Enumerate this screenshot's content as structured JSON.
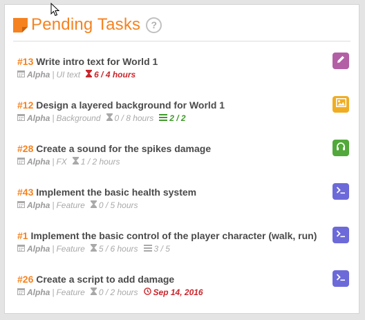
{
  "header": {
    "title": "Pending Tasks",
    "help": "?"
  },
  "colors": {
    "accent": "#f5821f",
    "overdue": "#c9262c",
    "done": "#3e9b27",
    "writing_badge": "#b35fa5",
    "art_badge": "#f0ad23",
    "sound_badge": "#52a83a",
    "code_badge": "#6c6ad9"
  },
  "tasks": [
    {
      "num": "#13",
      "title": "Write intro text for World 1",
      "milestone": "Alpha",
      "sep": "|",
      "category": "UI text",
      "hours": "6 / 4 hours",
      "badge_icon": "pencil-icon"
    },
    {
      "num": "#12",
      "title": "Design a layered background for World 1",
      "milestone": "Alpha",
      "sep": "|",
      "category": "Background",
      "hours": "0 / 8 hours",
      "subtasks": "2 / 2",
      "badge_icon": "image-icon"
    },
    {
      "num": "#28",
      "title": "Create a sound for the spikes damage",
      "milestone": "Alpha",
      "sep": "|",
      "category": "FX",
      "hours": "1 / 2 hours",
      "badge_icon": "headphones-icon"
    },
    {
      "num": "#43",
      "title": "Implement the basic health system",
      "milestone": "Alpha",
      "sep": "|",
      "category": "Feature",
      "hours": "0 / 5 hours",
      "badge_icon": "terminal-icon"
    },
    {
      "num": "#1",
      "title": "Implement the basic control of the player character (walk, run)",
      "milestone": "Alpha",
      "sep": "|",
      "category": "Feature",
      "hours": "5 / 6 hours",
      "subtasks": "3 / 5",
      "badge_icon": "terminal-icon"
    },
    {
      "num": "#26",
      "title": "Create a script to add damage",
      "milestone": "Alpha",
      "sep": "|",
      "category": "Feature",
      "hours": "0 / 2 hours",
      "due": "Sep 14, 2016",
      "badge_icon": "terminal-icon"
    }
  ]
}
